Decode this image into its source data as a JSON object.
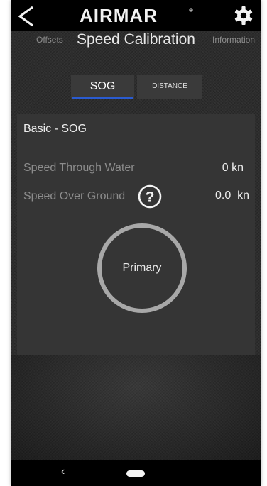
{
  "header": {
    "logo_text": "AIRMAR",
    "logo_registered": "®",
    "back_icon": "back-arrow-icon",
    "settings_icon": "gear-icon"
  },
  "nav": {
    "left_label": "Offsets",
    "title": "Speed Calibration",
    "right_label": "Information"
  },
  "tabs": [
    {
      "label": "SOG",
      "selected": true
    },
    {
      "label": "DISTANCE",
      "selected": false
    }
  ],
  "panel": {
    "title": "Basic - SOG",
    "speed_through_water": {
      "label": "Speed Through Water",
      "value": "0 kn"
    },
    "speed_over_ground": {
      "label": "Speed Over Ground",
      "help_icon": "question-circle-icon",
      "value": "0.0  kn"
    },
    "primary_button": "Primary"
  },
  "system_nav": {
    "back": "‹",
    "home_icon": "home-pill-icon"
  },
  "colors": {
    "background": "#2b2b2b",
    "panel": "#353535",
    "tab_accent": "#2a5bd0",
    "bars": "#000000"
  }
}
